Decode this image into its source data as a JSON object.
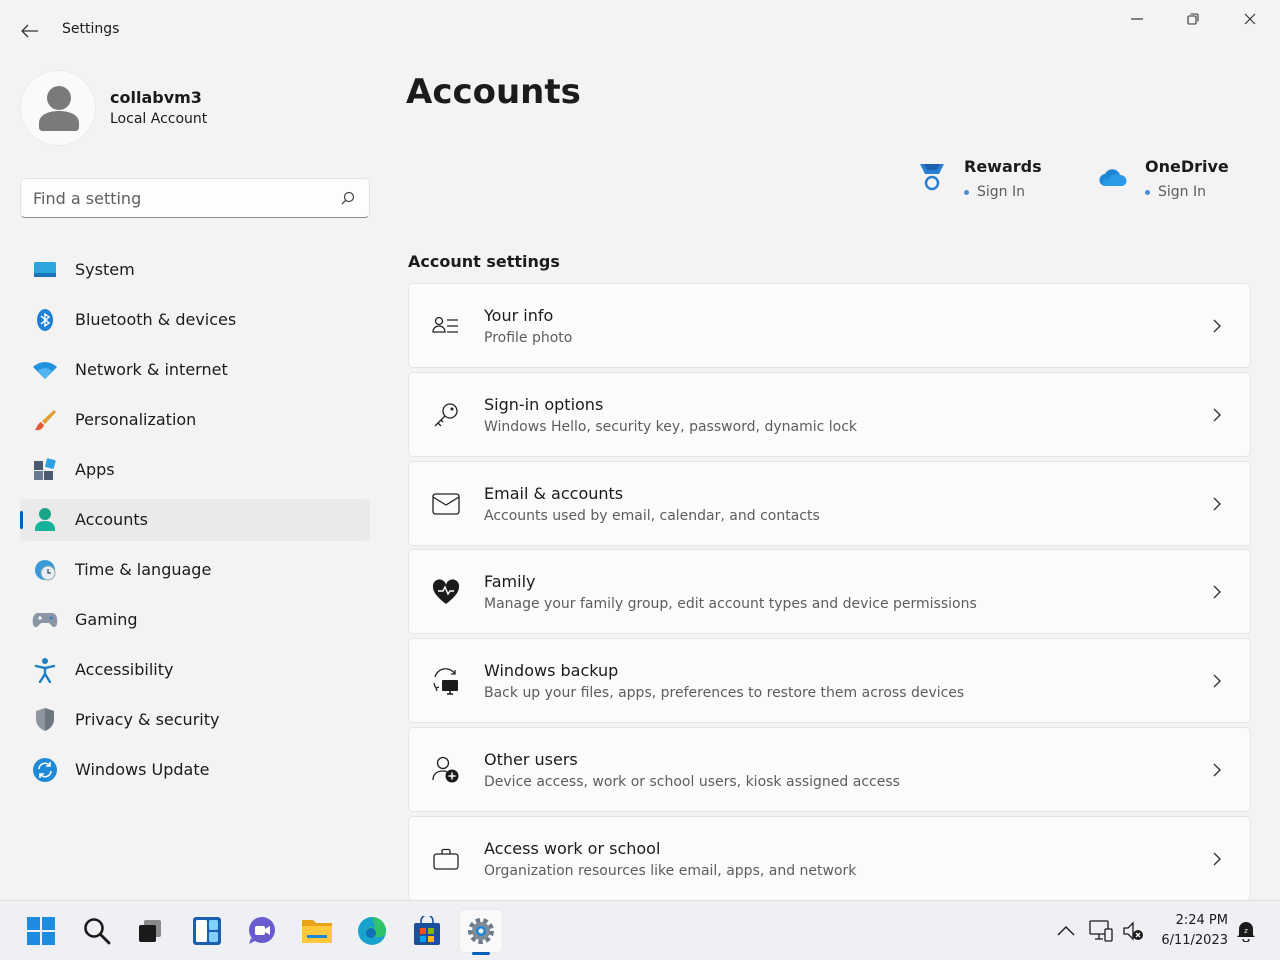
{
  "window": {
    "title": "Settings",
    "controls": [
      "minimize-icon",
      "restore-icon",
      "close-icon"
    ]
  },
  "profile": {
    "name": "collabvm3",
    "account_type": "Local Account"
  },
  "search": {
    "placeholder": "Find a setting",
    "value": ""
  },
  "sidebar": {
    "selected": "Accounts",
    "items": [
      {
        "label": "System",
        "icon": "system-icon"
      },
      {
        "label": "Bluetooth & devices",
        "icon": "bluetooth-icon"
      },
      {
        "label": "Network & internet",
        "icon": "wifi-icon"
      },
      {
        "label": "Personalization",
        "icon": "brush-icon"
      },
      {
        "label": "Apps",
        "icon": "apps-icon"
      },
      {
        "label": "Accounts",
        "icon": "accounts-icon"
      },
      {
        "label": "Time & language",
        "icon": "time-language-icon"
      },
      {
        "label": "Gaming",
        "icon": "gamepad-icon"
      },
      {
        "label": "Accessibility",
        "icon": "accessibility-icon"
      },
      {
        "label": "Privacy & security",
        "icon": "shield-icon"
      },
      {
        "label": "Windows Update",
        "icon": "update-icon"
      }
    ]
  },
  "main": {
    "title": "Accounts",
    "promos": [
      {
        "title": "Rewards",
        "link": "Sign In",
        "icon": "rewards-medal-icon"
      },
      {
        "title": "OneDrive",
        "link": "Sign In",
        "icon": "onedrive-cloud-icon"
      }
    ],
    "section_title": "Account settings",
    "cards": [
      {
        "title": "Your info",
        "subtitle": "Profile photo",
        "icon": "user-info-icon"
      },
      {
        "title": "Sign-in options",
        "subtitle": "Windows Hello, security key, password, dynamic lock",
        "icon": "key-icon"
      },
      {
        "title": "Email & accounts",
        "subtitle": "Accounts used by email, calendar, and contacts",
        "icon": "mail-icon"
      },
      {
        "title": "Family",
        "subtitle": "Manage your family group, edit account types and device permissions",
        "icon": "family-heart-icon"
      },
      {
        "title": "Windows backup",
        "subtitle": "Back up your files, apps, preferences to restore them across devices",
        "icon": "backup-icon"
      },
      {
        "title": "Other users",
        "subtitle": "Device access, work or school users, kiosk assigned access",
        "icon": "add-user-icon"
      },
      {
        "title": "Access work or school",
        "subtitle": "Organization resources like email, apps, and network",
        "icon": "briefcase-icon"
      }
    ]
  },
  "taskbar": {
    "apps": [
      "start-icon",
      "search-icon",
      "task-view-icon",
      "widgets-icon",
      "chat-icon",
      "file-explorer-icon",
      "edge-icon",
      "store-icon",
      "settings-icon"
    ],
    "active_app": "settings-icon",
    "tray": [
      "chevron-up-icon",
      "network-icon",
      "volume-muted-icon",
      "notification-icon"
    ],
    "time": "2:24 PM",
    "date": "6/11/2023"
  },
  "colors": {
    "accent": "#005fb8",
    "background": "#f3f3f3",
    "card": "#fbfbfb"
  }
}
